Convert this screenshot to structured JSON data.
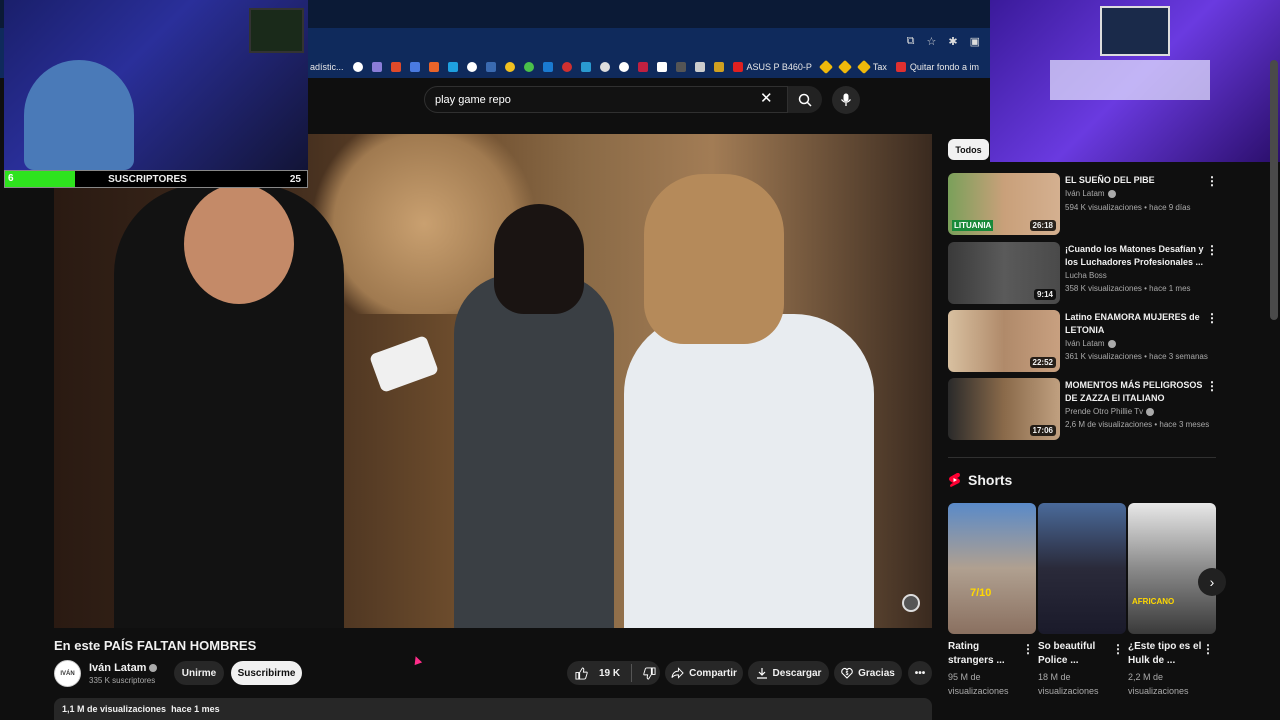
{
  "browser": {
    "bookmarks": [
      "adístic...",
      "",
      "",
      "",
      "",
      "",
      "",
      "",
      "",
      "",
      "",
      "",
      "",
      "",
      "",
      "",
      "",
      "",
      "",
      "",
      "",
      "",
      "ASUS P B460-P",
      "",
      "",
      "Tax",
      "Quitar fondo a im"
    ],
    "colors": {
      "tabstrip": "#0b1a36",
      "toolbar": "#0f2a5c"
    }
  },
  "search": {
    "query": "play game repo"
  },
  "overlay": {
    "sub_goal_label": "SUSCRIPTORES",
    "sub_goal_current": "6",
    "sub_goal_target": "25",
    "sub_goal_fraction": 0.24,
    "fill_color": "#2ee31e"
  },
  "video": {
    "title": "En este PAÍS FALTAN HOMBRES",
    "channel": "Iván Latam",
    "channel_avatar_text": "IVÁN",
    "subscribers": "335 K suscriptores",
    "join_label": "Unirme",
    "subscribe_label": "Suscribirme",
    "likes": "19 K",
    "share_label": "Compartir",
    "download_label": "Descargar",
    "thanks_label": "Gracias",
    "more_label": "•••",
    "views": "1,1 M de visualizaciones",
    "published": "hace 1 mes"
  },
  "sidebar": {
    "chip_all": "Todos",
    "recommendations": [
      {
        "title": "EL SUEÑO DEL PIBE",
        "channel": "Iván Latam",
        "verified": true,
        "meta": "594 K visualizaciones • hace 9 días",
        "duration": "26:18",
        "thumb_text": "LITUANIA"
      },
      {
        "title": "¡Cuando los Matones Desafían y los Luchadores Profesionales ...",
        "channel": "Lucha Boss",
        "verified": false,
        "meta": "358 K visualizaciones • hace 1 mes",
        "duration": "9:14",
        "thumb_text": ""
      },
      {
        "title": "Latino ENAMORA MUJERES de LETONIA",
        "channel": "Iván Latam",
        "verified": true,
        "meta": "361 K visualizaciones • hace 3 semanas",
        "duration": "22:52",
        "thumb_text": ""
      },
      {
        "title": "MOMENTOS MÁS PELIGROSOS DE ZAZZA El ITALIANO",
        "channel": "Prende Otro Phillie Tv",
        "verified": true,
        "meta": "2,6 M de visualizaciones • hace 3 meses",
        "duration": "17:06",
        "thumb_text": ""
      }
    ],
    "shorts_heading": "Shorts",
    "shorts": [
      {
        "title": "Rating strangers ...",
        "views": "95 M de visualizaciones",
        "thumb_text": "7/10"
      },
      {
        "title": "So beautiful Police ...",
        "views": "18 M de visualizaciones",
        "thumb_text": ""
      },
      {
        "title": "¿Este tipo es el Hulk de ...",
        "views": "2,2 M de visualizaciones",
        "thumb_text": "AFRICANO"
      }
    ]
  }
}
